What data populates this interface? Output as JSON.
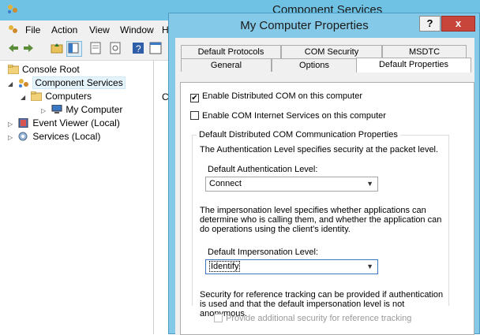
{
  "background_window": {
    "title": "Component Services",
    "menu": [
      "File",
      "Action",
      "View",
      "Window",
      "H"
    ],
    "menu_mnemonics": [
      "F",
      "A",
      "V",
      "W",
      "H"
    ]
  },
  "tree": {
    "items": [
      {
        "label": "Console Root"
      },
      {
        "label": "Component Services"
      },
      {
        "label": "Computers"
      },
      {
        "label": "My Computer"
      },
      {
        "label": "Event Viewer (Local)"
      },
      {
        "label": "Services (Local)"
      }
    ],
    "right_pane_letter": "C"
  },
  "dialog": {
    "title": "My Computer Properties",
    "help_label": "?",
    "close_label": "x",
    "tabs_row1": [
      "Default Protocols",
      "COM Security",
      "MSDTC"
    ],
    "tabs_row2": [
      "General",
      "Options",
      "Default Properties"
    ],
    "active_tab": "Default Properties",
    "enable_dcom": {
      "label": "Enable Distributed COM on this computer",
      "checked": true,
      "mark": "✔"
    },
    "enable_cis": {
      "label": "Enable COM Internet Services on this computer",
      "checked": false
    },
    "group_title": "Default Distributed COM Communication Properties",
    "auth_desc": "The Authentication Level specifies security at the packet level.",
    "auth_label": "Default Authentication Level:",
    "auth_value": "Connect",
    "imp_desc": "The impersonation level specifies whether applications can determine who is calling them, and whether the application can do operations using the client's identity.",
    "imp_label": "Default Impersonation Level:",
    "imp_value": "Identify",
    "ref_desc": "Security for reference tracking can be provided if authentication is used and that the default impersonation level is not anonymous.",
    "ref_checkbox": {
      "label": "Provide additional security for reference tracking",
      "checked": false,
      "enabled": false
    }
  }
}
